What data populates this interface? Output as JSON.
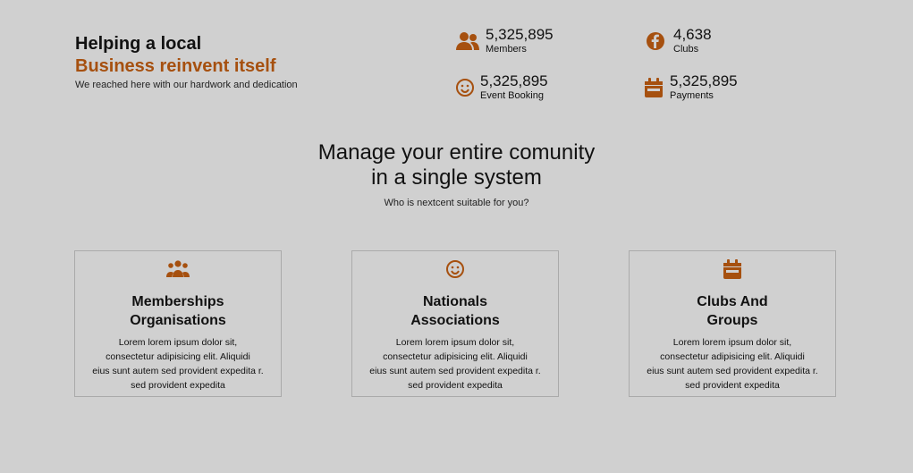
{
  "hero": {
    "title_line1": "Helping a local",
    "title_line2": "Business reinvent itself",
    "subtitle": "We reached here with our hardwork and dedication"
  },
  "stats": [
    {
      "value": "5,325,895",
      "label": "Members",
      "icon": "users-icon"
    },
    {
      "value": "4,638",
      "label": "Clubs",
      "icon": "facebook-icon"
    },
    {
      "value": "5,325,895",
      "label": "Event Booking",
      "icon": "smiley-icon"
    },
    {
      "value": "5,325,895",
      "label": "Payments",
      "icon": "calendar-icon"
    }
  ],
  "section": {
    "heading_line1": "Manage your entire comunity",
    "heading_line2": "in a single system",
    "subheading": "Who is nextcent suitable for you?"
  },
  "cards": [
    {
      "title": "Memberships\nOrganisations",
      "desc_lines": [
        "Lorem lorem ipsum dolor sit,",
        "consectetur adipisicing elit. Aliquidi",
        "eius sunt autem sed provident expedita r.",
        "sed provident expedita"
      ],
      "icon": "users-icon"
    },
    {
      "title": "Nationals\nAssociations",
      "desc_lines": [
        "Lorem lorem ipsum dolor sit,",
        "consectetur adipisicing elit. Aliquidi",
        "eius sunt autem sed provident expedita r.",
        "sed provident expedita"
      ],
      "icon": "smiley-icon"
    },
    {
      "title": "Clubs And\nGroups",
      "desc_lines": [
        "Lorem lorem ipsum dolor sit,",
        "consectetur adipisicing elit. Aliquidi",
        "eius sunt autem sed provident expedita r.",
        "sed provident expedita"
      ],
      "icon": "calendar-icon"
    }
  ],
  "colors": {
    "accent": "#a6500f",
    "background": "#d0d0d0",
    "card_border": "#aaaaaa"
  }
}
